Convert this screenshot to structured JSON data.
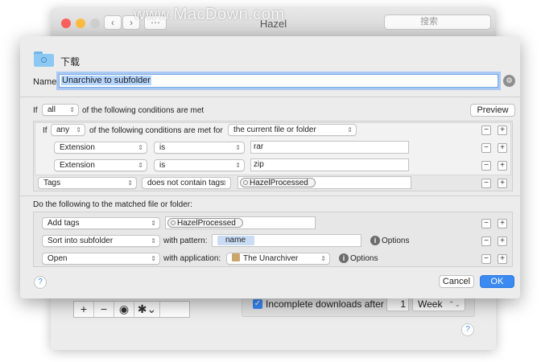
{
  "background_window": {
    "title": "Hazel",
    "search_placeholder": "搜索",
    "watermark": "www.MacDown.com",
    "nav_back": "‹",
    "nav_forward": "›",
    "grid_icon": "⋯",
    "toolbar": {
      "add": "+",
      "remove": "−",
      "eye": "◉",
      "gear": "✱⌄"
    },
    "incomplete_downloads_label": "Incomplete downloads after",
    "incomplete_downloads_value": "1",
    "incomplete_downloads_unit": "Week",
    "help": "?"
  },
  "sheet": {
    "folder_name": "下载",
    "name_label": "Name:",
    "rule_name": "Unarchive to subfolder",
    "if_label": "If",
    "match_all": "all",
    "conditions_suffix": "of the following conditions are met",
    "preview_button": "Preview",
    "nested": {
      "if_label": "If",
      "match_any": "any",
      "text": "of the following conditions are met for",
      "target": "the current file or folder",
      "conditions": [
        {
          "attribute": "Extension",
          "operator": "is",
          "value": "rar"
        },
        {
          "attribute": "Extension",
          "operator": "is",
          "value": "zip"
        }
      ]
    },
    "tags_condition": {
      "attribute": "Tags",
      "operator": "does not contain tags",
      "token": "HazelProcessed"
    },
    "actions_heading": "Do the following to the matched file or folder:",
    "actions": [
      {
        "action": "Add tags",
        "token": "HazelProcessed"
      },
      {
        "action": "Sort into subfolder",
        "with_label": "with pattern:",
        "pattern_token": "name",
        "options": "Options"
      },
      {
        "action": "Open",
        "with_label": "with application:",
        "app": "The Unarchiver",
        "options": "Options"
      }
    ],
    "minus": "−",
    "plus": "+",
    "help": "?",
    "cancel_button": "Cancel",
    "ok_button": "OK"
  },
  "colors": {
    "accent": "#3b8af2",
    "selection": "#b4d5fe",
    "close": "#fc605c",
    "minimize": "#fdbc40",
    "zoom": "#cfcfcf"
  }
}
